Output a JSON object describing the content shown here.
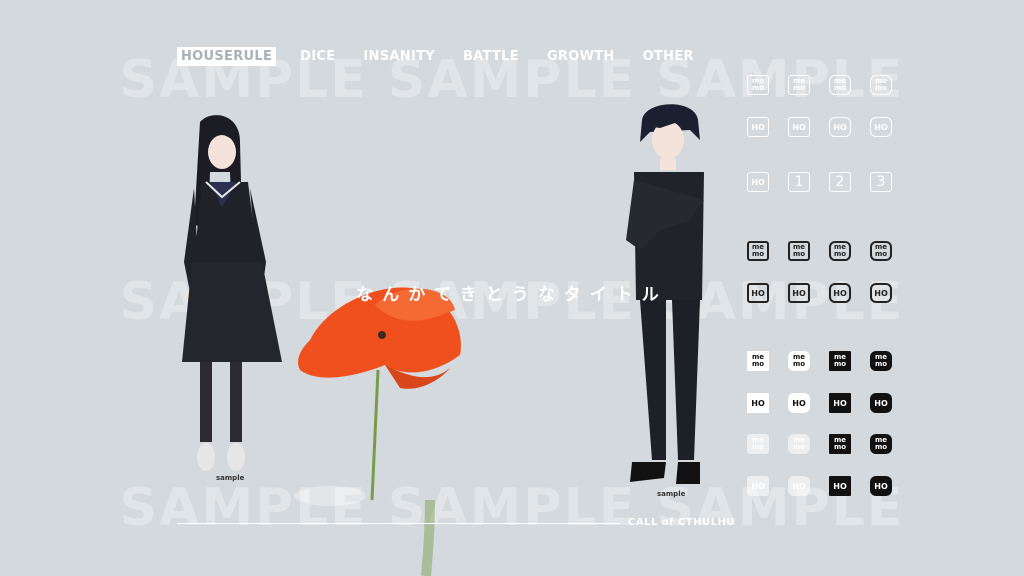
{
  "watermark": "SAMPLE SAMPLE SAMPLE",
  "nav": {
    "items": [
      {
        "label": "HOUSERULE",
        "active": true
      },
      {
        "label": "DICE",
        "active": false
      },
      {
        "label": "INSANITY",
        "active": false
      },
      {
        "label": "BATTLE",
        "active": false
      },
      {
        "label": "GROWTH",
        "active": false
      },
      {
        "label": "OTHER",
        "active": false
      }
    ]
  },
  "title": "なんかてきとうなタイトル",
  "footer": {
    "label": "CALL of CTHULHU"
  },
  "characters": {
    "left_caption": "sample",
    "right_caption": "sample"
  },
  "icons": {
    "memo_top": "me",
    "memo_bottom": "mo",
    "ho": "HO",
    "numbers": [
      "1",
      "2",
      "3"
    ]
  },
  "colors": {
    "background": "#d4d9dd",
    "flower": "#f0501e",
    "stem": "#7a9a4a",
    "uniform": "#1f2228"
  }
}
